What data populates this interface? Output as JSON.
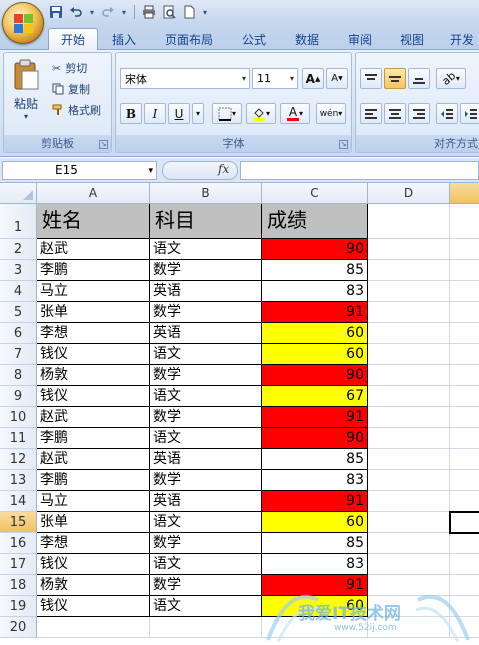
{
  "titlebar": {
    "office_button": "office-button",
    "quick_access": [
      "save-icon",
      "undo-icon",
      "redo-icon",
      "print-icon",
      "print-preview-icon",
      "new-icon"
    ]
  },
  "tabs": [
    {
      "label": "开始",
      "active": true
    },
    {
      "label": "插入",
      "active": false
    },
    {
      "label": "页面布局",
      "active": false
    },
    {
      "label": "公式",
      "active": false
    },
    {
      "label": "数据",
      "active": false
    },
    {
      "label": "审阅",
      "active": false
    },
    {
      "label": "视图",
      "active": false
    },
    {
      "label": "开发",
      "active": false
    }
  ],
  "ribbon": {
    "clipboard": {
      "label": "剪贴板",
      "paste": "粘贴",
      "cut": "剪切",
      "copy": "复制",
      "format_painter": "格式刷"
    },
    "font": {
      "label": "字体",
      "font_name": "宋体",
      "font_size": "11",
      "bold": "B",
      "italic": "I",
      "underline": "U",
      "grow": "A",
      "shrink": "A",
      "font_color": "A",
      "phonetic": "wén"
    },
    "alignment": {
      "label": "对齐方式"
    }
  },
  "formula_bar": {
    "name_box": "E15",
    "fx_label": "fx",
    "formula": ""
  },
  "grid": {
    "columns": [
      "A",
      "B",
      "C",
      "D"
    ],
    "header_row": {
      "name": "姓名",
      "subject": "科目",
      "score": "成绩"
    },
    "rows": [
      {
        "row": "2",
        "name": "赵武",
        "subject": "语文",
        "score": "90",
        "fill": "red"
      },
      {
        "row": "3",
        "name": "李鹏",
        "subject": "数学",
        "score": "85",
        "fill": "none"
      },
      {
        "row": "4",
        "name": "马立",
        "subject": "英语",
        "score": "83",
        "fill": "none"
      },
      {
        "row": "5",
        "name": "张单",
        "subject": "数学",
        "score": "91",
        "fill": "red"
      },
      {
        "row": "6",
        "name": "李想",
        "subject": "英语",
        "score": "60",
        "fill": "yellow"
      },
      {
        "row": "7",
        "name": "钱仪",
        "subject": "语文",
        "score": "60",
        "fill": "yellow"
      },
      {
        "row": "8",
        "name": "杨敦",
        "subject": "数学",
        "score": "90",
        "fill": "red"
      },
      {
        "row": "9",
        "name": "钱仪",
        "subject": "语文",
        "score": "67",
        "fill": "yellow"
      },
      {
        "row": "10",
        "name": "赵武",
        "subject": "数学",
        "score": "91",
        "fill": "red"
      },
      {
        "row": "11",
        "name": "李鹏",
        "subject": "语文",
        "score": "90",
        "fill": "red"
      },
      {
        "row": "12",
        "name": "赵武",
        "subject": "英语",
        "score": "85",
        "fill": "none"
      },
      {
        "row": "13",
        "name": "李鹏",
        "subject": "数学",
        "score": "83",
        "fill": "none"
      },
      {
        "row": "14",
        "name": "马立",
        "subject": "英语",
        "score": "91",
        "fill": "red"
      },
      {
        "row": "15",
        "name": "张单",
        "subject": "语文",
        "score": "60",
        "fill": "yellow"
      },
      {
        "row": "16",
        "name": "李想",
        "subject": "数学",
        "score": "85",
        "fill": "none"
      },
      {
        "row": "17",
        "name": "钱仪",
        "subject": "语文",
        "score": "83",
        "fill": "none"
      },
      {
        "row": "18",
        "name": "杨敦",
        "subject": "数学",
        "score": "91",
        "fill": "red"
      },
      {
        "row": "19",
        "name": "钱仪",
        "subject": "语文",
        "score": "60",
        "fill": "yellow"
      }
    ],
    "header_row_number": "1",
    "empty_row_number": "20",
    "active_row": "15",
    "colors": {
      "red": "#ff0000",
      "yellow": "#ffff00",
      "header_fill": "#c0c0c0"
    }
  },
  "watermark": {
    "text": "我爱IT技术网",
    "url_text": "www.52ij.com"
  }
}
